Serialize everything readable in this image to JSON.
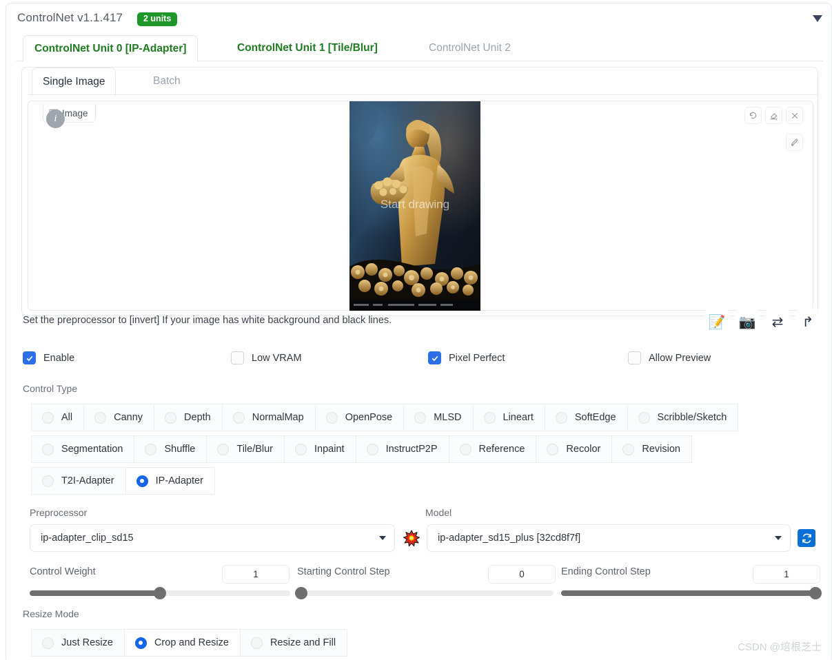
{
  "header": {
    "title": "ControlNet v1.1.417",
    "units_badge": "2 units",
    "collapse_icon": "triangle-down-icon",
    "badge_color": "#1f9628"
  },
  "unit_tabs": [
    {
      "label": "ControlNet Unit 0 [IP-Adapter]",
      "active": true
    },
    {
      "label": "ControlNet Unit 1 [Tile/Blur]",
      "active": false
    },
    {
      "label": "ControlNet Unit 2",
      "active": false,
      "disabled": true
    }
  ],
  "sub_tabs": [
    {
      "label": "Single Image",
      "active": true
    },
    {
      "label": "Batch",
      "active": false
    }
  ],
  "image_area": {
    "tag_label": "Image",
    "tag_icon": "image-icon",
    "info_icon": "info-icon",
    "info_glyph": "i",
    "overlay_text": "Start drawing",
    "toolbar": [
      {
        "name": "undo-icon"
      },
      {
        "name": "eraser-icon"
      },
      {
        "name": "close-icon"
      }
    ],
    "edit_icon": "pen-icon"
  },
  "hint": "Set the preprocessor to [invert] If your image has white background and black lines.",
  "action_buttons": [
    {
      "name": "open-new-canvas-button",
      "glyph": "📝"
    },
    {
      "name": "webcam-button",
      "glyph": "📷"
    },
    {
      "name": "mirror-webcam-button",
      "glyph": "⇄"
    },
    {
      "name": "send-dimensions-button",
      "glyph": "↱"
    }
  ],
  "checkboxes": [
    {
      "label": "Enable",
      "checked": true
    },
    {
      "label": "Low VRAM",
      "checked": false
    },
    {
      "label": "Pixel Perfect",
      "checked": true
    },
    {
      "label": "Allow Preview",
      "checked": false
    }
  ],
  "control_type": {
    "label": "Control Type",
    "rows": [
      [
        {
          "label": "All",
          "selected": false
        },
        {
          "label": "Canny",
          "selected": false
        },
        {
          "label": "Depth",
          "selected": false
        },
        {
          "label": "NormalMap",
          "selected": false
        },
        {
          "label": "OpenPose",
          "selected": false
        },
        {
          "label": "MLSD",
          "selected": false
        },
        {
          "label": "Lineart",
          "selected": false
        },
        {
          "label": "SoftEdge",
          "selected": false
        },
        {
          "label": "Scribble/Sketch",
          "selected": false
        }
      ],
      [
        {
          "label": "Segmentation",
          "selected": false
        },
        {
          "label": "Shuffle",
          "selected": false
        },
        {
          "label": "Tile/Blur",
          "selected": false
        },
        {
          "label": "Inpaint",
          "selected": false
        },
        {
          "label": "InstructP2P",
          "selected": false
        },
        {
          "label": "Reference",
          "selected": false
        },
        {
          "label": "Recolor",
          "selected": false
        },
        {
          "label": "Revision",
          "selected": false
        }
      ],
      [
        {
          "label": "T2I-Adapter",
          "selected": false
        },
        {
          "label": "IP-Adapter",
          "selected": true
        }
      ]
    ]
  },
  "preprocessor": {
    "label": "Preprocessor",
    "value": "ip-adapter_clip_sd15",
    "run_icon": "explosion-icon"
  },
  "model": {
    "label": "Model",
    "value": "ip-adapter_sd15_plus [32cd8f7f]",
    "refresh_icon": "refresh-icon",
    "refresh_color": "#0a6fd6"
  },
  "sliders": [
    {
      "label": "Control Weight",
      "value": "1",
      "fill_pct": 50
    },
    {
      "label": "Starting Control Step",
      "value": "0",
      "fill_pct": 0
    },
    {
      "label": "Ending Control Step",
      "value": "1",
      "fill_pct": 100
    }
  ],
  "resize_mode": {
    "label": "Resize Mode",
    "options": [
      {
        "label": "Just Resize",
        "selected": false
      },
      {
        "label": "Crop and Resize",
        "selected": true
      },
      {
        "label": "Resize and Fill",
        "selected": false
      }
    ]
  },
  "watermark": "CSDN @培根芝士",
  "accent_color": "#1367e8"
}
